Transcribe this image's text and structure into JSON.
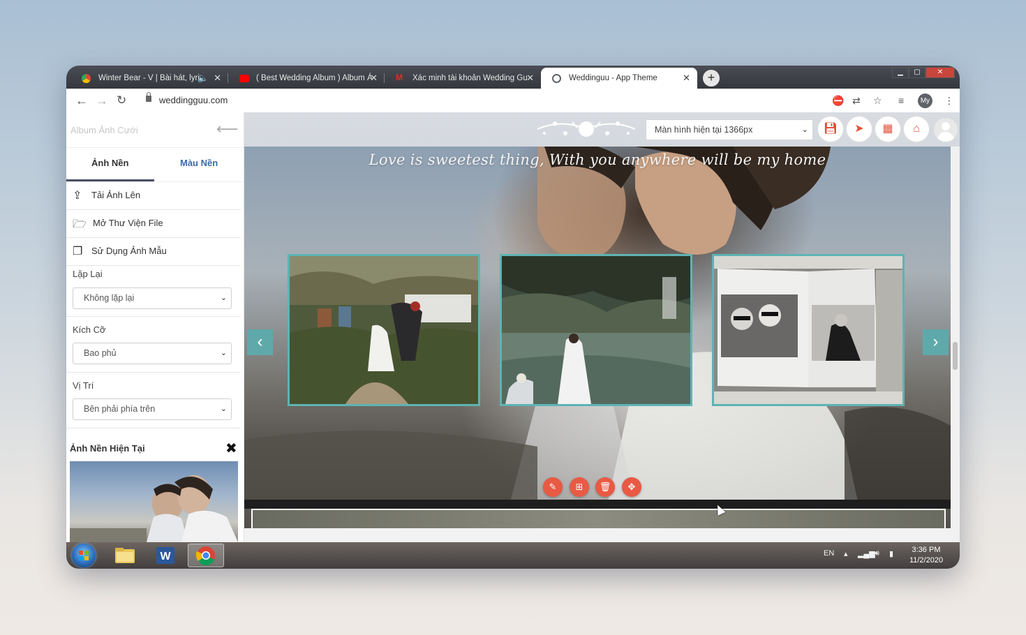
{
  "browser": {
    "tabs": [
      {
        "title": "Winter Bear - V | Bài hát, lyri",
        "favicon_color": "#4285f4",
        "active": false
      },
      {
        "title": "( Best Wedding Album ) Album Á",
        "favicon_color": "#ff0000",
        "active": false
      },
      {
        "title": "Xác minh tài khoản Wedding Gu",
        "favicon_color": "#d93025",
        "active": false
      },
      {
        "title": "Weddinguu - App Theme",
        "favicon_color": "#5f6368",
        "active": true
      }
    ],
    "new_tab_label": "+",
    "url": "weddingguu.com",
    "profile_initials": "My"
  },
  "sidebar": {
    "title": "Album Ảnh Cưới",
    "tabs": [
      {
        "label": "Ảnh Nền",
        "active": true
      },
      {
        "label": "Màu Nền",
        "active": false
      }
    ],
    "actions": [
      {
        "label": "Tải Ảnh Lên",
        "icon": "upload-icon"
      },
      {
        "label": "Mở Thư Viện File",
        "icon": "folder-open-icon"
      },
      {
        "label": "Sử Dụng Ảnh Mẫu",
        "icon": "copy-icon"
      }
    ],
    "repeat": {
      "label": "Lặp Lại",
      "value": "Không lặp lại"
    },
    "size": {
      "label": "Kích Cỡ",
      "value": "Bao phủ"
    },
    "position": {
      "label": "Vị Trí",
      "value": "Bên phải phía trên"
    },
    "current_bg_label": "Ảnh Nền Hiện Tại"
  },
  "main": {
    "screen_select": "Màn hình hiện tại 1366px",
    "quote": "Love is sweetest thing, With you anywhere will be my home",
    "toolbar_icons": [
      "save-icon",
      "send-icon",
      "grid-icon",
      "home-icon"
    ],
    "photos": [
      {
        "name": "wedding-photo-1",
        "desc_colors": [
          "#6b7a55",
          "#a49b78",
          "#3f4a2e"
        ]
      },
      {
        "name": "wedding-photo-2",
        "desc_colors": [
          "#3c4a3a",
          "#687e72",
          "#2a3228"
        ]
      },
      {
        "name": "wedding-photo-3",
        "desc_colors": [
          "#d8d6d2",
          "#5d5c5a",
          "#efefef"
        ]
      }
    ],
    "action_icons": [
      "edit-icon",
      "add-icon",
      "delete-icon",
      "move-icon"
    ]
  },
  "taskbar": {
    "language": "EN",
    "time": "3:36 PM",
    "date": "11/2/2020"
  },
  "colors": {
    "accent_teal": "#5fb3b3",
    "action_red": "#e85a43",
    "sidebar_tab_active": "#333333",
    "sidebar_tab_inactive": "#3a6aa8"
  }
}
